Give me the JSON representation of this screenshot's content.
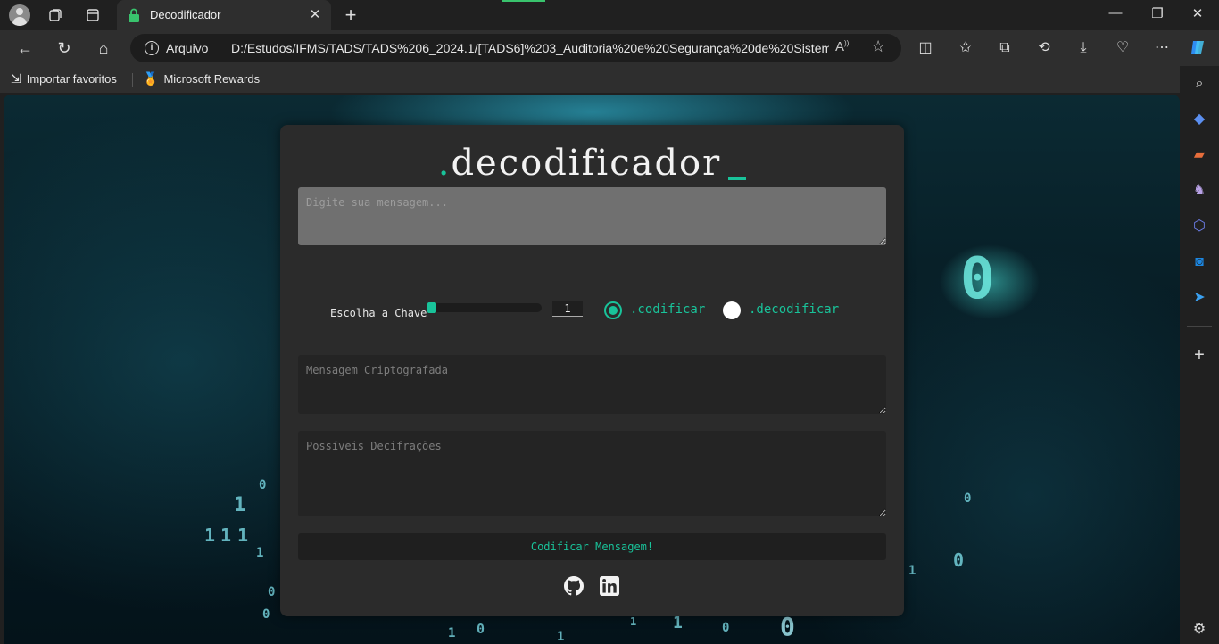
{
  "browser": {
    "tab_title": "Decodificador",
    "address_scheme": "Arquivo",
    "address_url": "D:/Estudos/IFMS/TADS/TADS%206_2024.1/[TADS6]%203_Auditoria%20e%20Segurança%20de%20Sistema...",
    "favorites": [
      "Importar favoritos",
      "Microsoft Rewards"
    ],
    "accent": "#39c36d"
  },
  "app": {
    "logo_dot": ".",
    "logo_text": "decodificador",
    "message_placeholder": "Digite sua mensagem...",
    "key_label": "Escolha a Chave",
    "key_value": "1",
    "slider_level": 0,
    "mode_encode": ".codificar",
    "mode_decode": ".decodificar",
    "selected_mode": "codificar",
    "encrypted_placeholder": "Mensagem Criptografada",
    "decipher_placeholder": "Possíveis Decifrações",
    "submit_label": "Codificar Mensagem!",
    "social_icons": [
      "github-icon",
      "linkedin-icon"
    ],
    "accent": "#19c39a"
  },
  "background_glyphs": [
    "0",
    "1",
    "0",
    "1",
    "1",
    "1",
    "0",
    "1",
    "0",
    "1",
    "1",
    "0",
    "1",
    "0",
    "1",
    "0",
    "1",
    "0",
    "0"
  ]
}
